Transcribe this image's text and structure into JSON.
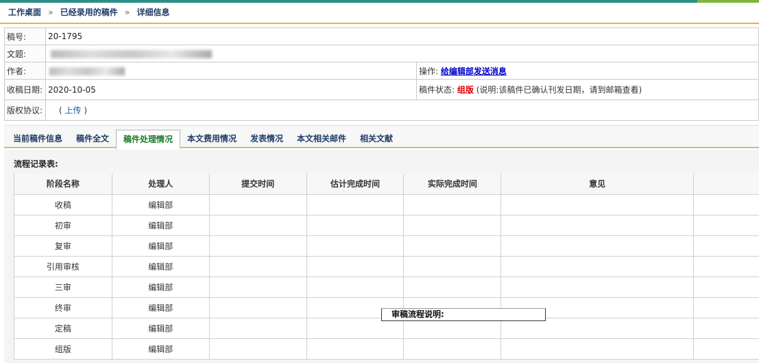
{
  "breadcrumb": {
    "home": "工作桌面",
    "accepted": "已经录用的稿件",
    "current": "详细信息",
    "sep": "»"
  },
  "info": {
    "manuscript_no_label": "稿号:",
    "manuscript_no": "20-1795",
    "title_label": "文题:",
    "author_label": "作者:",
    "operation_label": "操作:",
    "operation_link": "给编辑部发送消息",
    "received_label": "收稿日期:",
    "received_date": "2020-10-05",
    "status_label": "稿件状态:",
    "status_value": "组版",
    "status_note": "(说明:该稿件已确认刊发日期，请到邮箱查看)",
    "copyright_label": "版权协议:",
    "copyright_paren_open": "(",
    "upload_link": "上传",
    "copyright_paren_close": ")"
  },
  "tabs": [
    {
      "label": "当前稿件信息"
    },
    {
      "label": "稿件全文"
    },
    {
      "label": "稿件处理情况"
    },
    {
      "label": "本文费用情况"
    },
    {
      "label": "发表情况"
    },
    {
      "label": "本文相关邮件"
    },
    {
      "label": "相关文献"
    }
  ],
  "flow": {
    "title": "流程记录表:",
    "headers": [
      "阶段名称",
      "处理人",
      "提交时间",
      "估计完成时间",
      "实际完成时间",
      "意见"
    ],
    "rows": [
      {
        "stage": "收稿",
        "handler": "编辑部"
      },
      {
        "stage": "初审",
        "handler": "编辑部"
      },
      {
        "stage": "复审",
        "handler": "编辑部"
      },
      {
        "stage": "引用审核",
        "handler": "编辑部"
      },
      {
        "stage": "三审",
        "handler": "编辑部"
      },
      {
        "stage": "终审",
        "handler": "编辑部"
      },
      {
        "stage": "定稿",
        "handler": "编辑部"
      },
      {
        "stage": "组版",
        "handler": "编辑部"
      }
    ]
  },
  "tooltip": {
    "text": "审稿流程说明:"
  },
  "colors": {
    "topbar": "#2a8f86",
    "breadcrumb_text": "#1f3c67",
    "breadcrumb_underline": "#f0b041",
    "status_red": "#e00000",
    "tab_active": "#1b7a28"
  }
}
